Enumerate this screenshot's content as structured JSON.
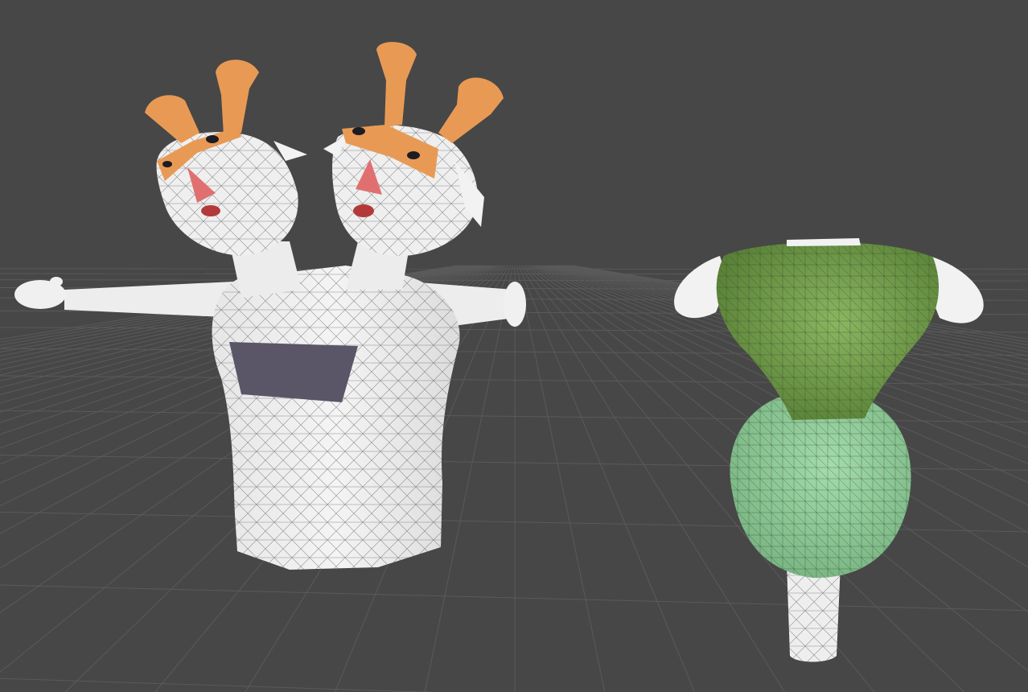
{
  "scene_view": {
    "background_color": "#474747",
    "grid_line_color": "#5a5a5a",
    "wire_color": "#3a3a3a"
  },
  "models": [
    {
      "id": "two-headed-character",
      "colors": {
        "body": "#eeeeee",
        "body_shade": "#d8d8d8",
        "antenna": "#e89a55",
        "antenna_shade": "#d98a45",
        "nose": "#e07070",
        "mouth": "#b33a3a",
        "eye": "#1c1c22",
        "chest_panel": "#5a5668"
      }
    },
    {
      "id": "vase-shape",
      "colors": {
        "upper_bowl": "#6f9a48",
        "upper_bowl_shade": "#5a8238",
        "lower_body": "#8fcc98",
        "lower_body_shade": "#7fbb88",
        "white_parts": "#f2f2f2",
        "stem": "#eeeeee"
      }
    }
  ]
}
